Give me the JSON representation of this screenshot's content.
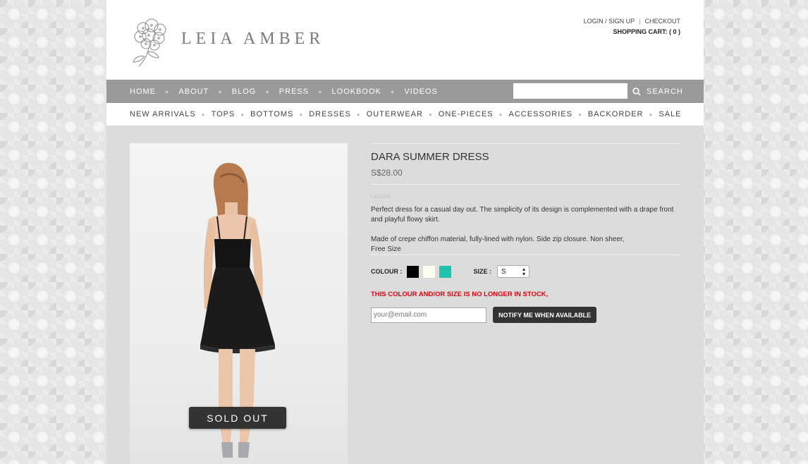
{
  "brand": {
    "name": "LEIA AMBER"
  },
  "top_links": {
    "login": "LOGIN / SIGN UP",
    "separator": "|",
    "checkout": "CHECKOUT",
    "cart": "SHOPPING CART: ( 0 )"
  },
  "main_nav": [
    "HOME",
    "ABOUT",
    "BLOG",
    "PRESS",
    "LOOKBOOK",
    "VIDEOS"
  ],
  "search": {
    "placeholder": "",
    "button_label": "SEARCH",
    "icon": "search-icon"
  },
  "category_nav": [
    "NEW ARRIVALS",
    "TOPS",
    "BOTTOMS",
    "DRESSES",
    "OUTERWEAR",
    "ONE-PIECES",
    "ACCESSORIES",
    "BACKORDER",
    "SALE"
  ],
  "product": {
    "title": "DARA SUMMER DRESS",
    "price": "S$28.00",
    "sku": "LA1004",
    "description_1": "Perfect dress for a casual day out. The simplicity of its design is complemented with a drape front and playful flowy skirt.",
    "description_2a": "Made of crepe chiffon material, fully-lined with nylon. Side zip closure. Non sheer,",
    "description_2b": "Free Size",
    "badge": "SOLD OUT"
  },
  "options": {
    "colour_label": "COLOUR :",
    "colours": [
      "#000000",
      "#fdfdf0",
      "#1fc2ad"
    ],
    "size_label": "SIZE :",
    "size_value": "S"
  },
  "stock_message": "THIS COLOUR AND/OR SIZE IS NO LONGER IN STOCK,",
  "notify": {
    "email_placeholder": "your@email.com",
    "button_label": "NOTIFY ME WHEN AVAILABLE"
  }
}
